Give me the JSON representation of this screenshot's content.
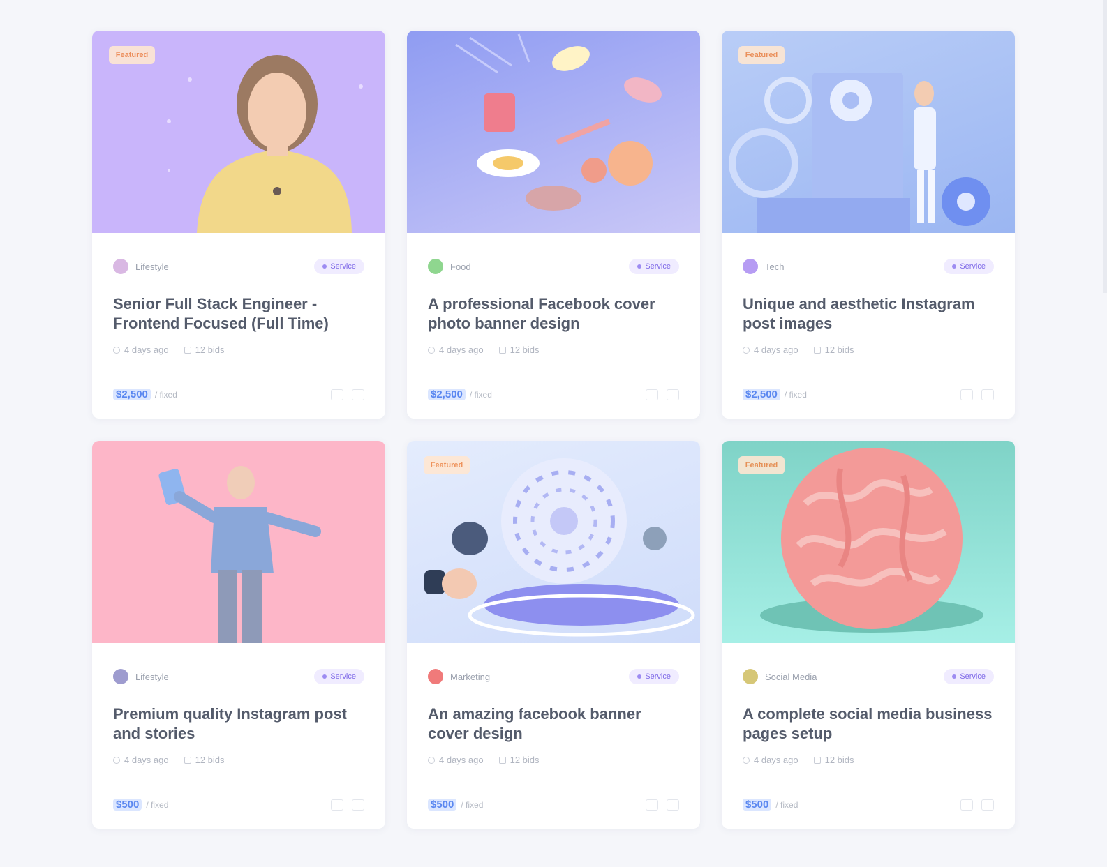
{
  "cards": [
    {
      "badge": "Featured",
      "author": "Lifestyle",
      "category": "Service",
      "title": "Senior Full Stack Engineer - Frontend Focused (Full Time)",
      "stat1": "4 days ago",
      "stat2": "12 bids",
      "price": "$2,500",
      "price_unit": "/ fixed",
      "colors": {
        "thumb_bg": "#c9b5fb",
        "avatar": "#d9b8e3"
      }
    },
    {
      "badge": "",
      "author": "Food",
      "category": "Service",
      "title": "A professional Facebook cover photo banner design",
      "stat1": "4 days ago",
      "stat2": "12 bids",
      "price": "$2,500",
      "price_unit": "/ fixed",
      "colors": {
        "thumb_bg": "#a8aef3",
        "avatar": "#8fd68f"
      }
    },
    {
      "badge": "Featured",
      "author": "Tech",
      "category": "Service",
      "title": "Unique and aesthetic Instagram post images",
      "stat1": "4 days ago",
      "stat2": "12 bids",
      "price": "$2,500",
      "price_unit": "/ fixed",
      "colors": {
        "thumb_bg": "#a9c4f5",
        "avatar": "#b69cf3"
      }
    },
    {
      "badge": "",
      "author": "Lifestyle",
      "category": "Service",
      "title": "Premium quality Instagram post and stories",
      "stat1": "4 days ago",
      "stat2": "12 bids",
      "price": "$500",
      "price_unit": "/ fixed",
      "colors": {
        "thumb_bg": "#fdb6c8",
        "avatar": "#9e9ccf"
      }
    },
    {
      "badge": "Featured",
      "author": "Marketing",
      "category": "Service",
      "title": "An amazing facebook banner cover design",
      "stat1": "4 days ago",
      "stat2": "12 bids",
      "price": "$500",
      "price_unit": "/ fixed",
      "colors": {
        "thumb_bg": "#dbe7fb",
        "avatar": "#f07a7a"
      }
    },
    {
      "badge": "Featured",
      "author": "Social Media",
      "category": "Service",
      "title": "A complete social media business pages setup",
      "stat1": "4 days ago",
      "stat2": "12 bids",
      "price": "$500",
      "price_unit": "/ fixed",
      "colors": {
        "thumb_bg": "#8fe0d6",
        "avatar": "#d6c777"
      }
    }
  ]
}
